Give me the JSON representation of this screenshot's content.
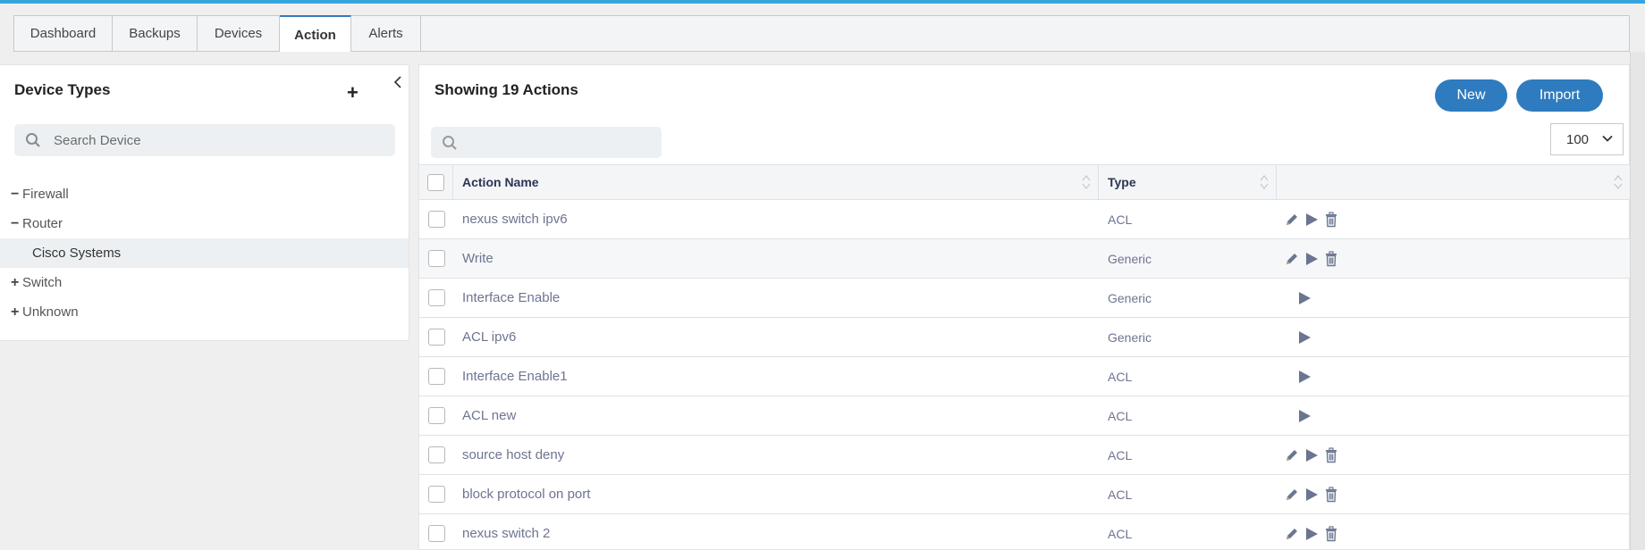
{
  "tabs": [
    {
      "label": "Dashboard",
      "active": false
    },
    {
      "label": "Backups",
      "active": false
    },
    {
      "label": "Devices",
      "active": false
    },
    {
      "label": "Action",
      "active": true
    },
    {
      "label": "Alerts",
      "active": false
    }
  ],
  "sidebar": {
    "title": "Device Types",
    "add_icon": "plus-icon",
    "collapse_icon": "chevron-left-icon",
    "search_placeholder": "Search Device",
    "tree": [
      {
        "label": "Firewall",
        "toggle": "−",
        "level": 0
      },
      {
        "label": "Router",
        "toggle": "−",
        "level": 0
      },
      {
        "label": "Cisco Systems",
        "toggle": "",
        "level": 1,
        "selected": true
      },
      {
        "label": "Switch",
        "toggle": "+",
        "level": 0
      },
      {
        "label": "Unknown",
        "toggle": "+",
        "level": 0
      }
    ]
  },
  "main": {
    "title": "Showing 19 Actions",
    "new_label": "New",
    "import_label": "Import",
    "search_value": "",
    "page_size": "100",
    "columns": {
      "name": "Action Name",
      "type": "Type",
      "actions": ""
    },
    "rows": [
      {
        "name": "nexus switch ipv6",
        "type": "ACL",
        "actions": [
          "edit",
          "run",
          "delete"
        ]
      },
      {
        "name": "Write",
        "type": "Generic",
        "actions": [
          "edit",
          "run",
          "delete"
        ]
      },
      {
        "name": "Interface Enable",
        "type": "Generic",
        "actions": [
          "run"
        ]
      },
      {
        "name": "ACL ipv6",
        "type": "Generic",
        "actions": [
          "run"
        ]
      },
      {
        "name": "Interface Enable1",
        "type": "ACL",
        "actions": [
          "run"
        ]
      },
      {
        "name": "ACL new",
        "type": "ACL",
        "actions": [
          "run"
        ]
      },
      {
        "name": "source host deny",
        "type": "ACL",
        "actions": [
          "edit",
          "run",
          "delete"
        ]
      },
      {
        "name": "block protocol on port",
        "type": "ACL",
        "actions": [
          "edit",
          "run",
          "delete"
        ]
      },
      {
        "name": "nexus switch 2",
        "type": "ACL",
        "actions": [
          "edit",
          "run",
          "delete"
        ]
      }
    ]
  },
  "colors": {
    "accent": "#2f7bbf",
    "topbar": "#35a6dd",
    "icon": "#6b7591"
  }
}
